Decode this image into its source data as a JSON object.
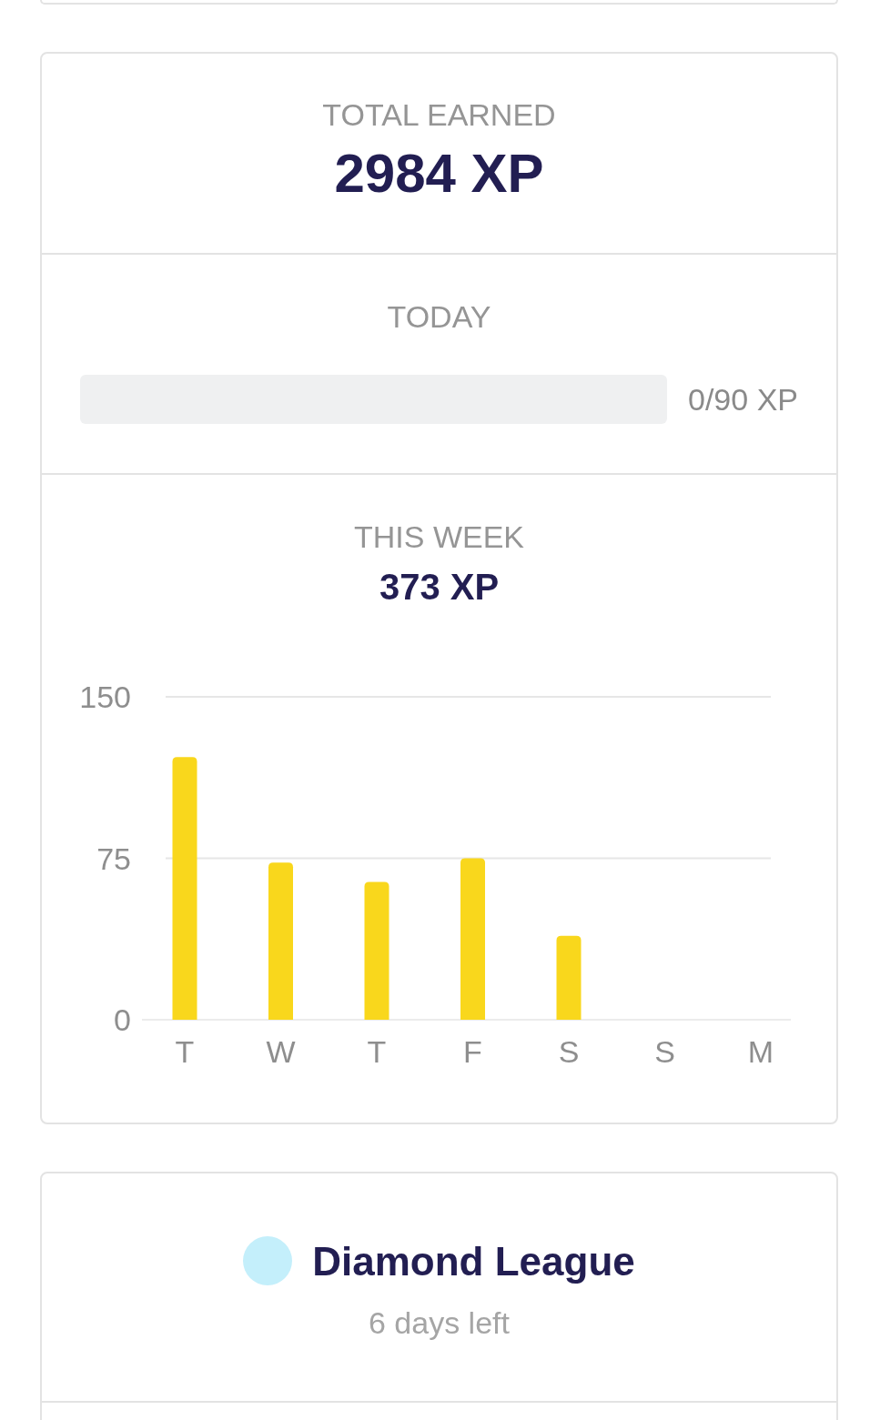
{
  "total_earned": {
    "label": "TOTAL EARNED",
    "value": "2984 XP"
  },
  "today": {
    "label": "TODAY",
    "level": 0,
    "reading": "0/90 XP"
  },
  "this_week": {
    "label": "THIS WEEK",
    "value": "373 XP",
    "chart_data": {
      "type": "bar",
      "categories": [
        "T",
        "W",
        "T",
        "F",
        "S",
        "S",
        "M"
      ],
      "values": [
        122,
        73,
        64,
        75,
        39,
        0,
        null
      ],
      "ylim": [
        0,
        150
      ],
      "yticks": [
        0,
        75,
        150
      ]
    }
  },
  "league": {
    "name": "Diamond League",
    "time_left": "6 days left"
  }
}
